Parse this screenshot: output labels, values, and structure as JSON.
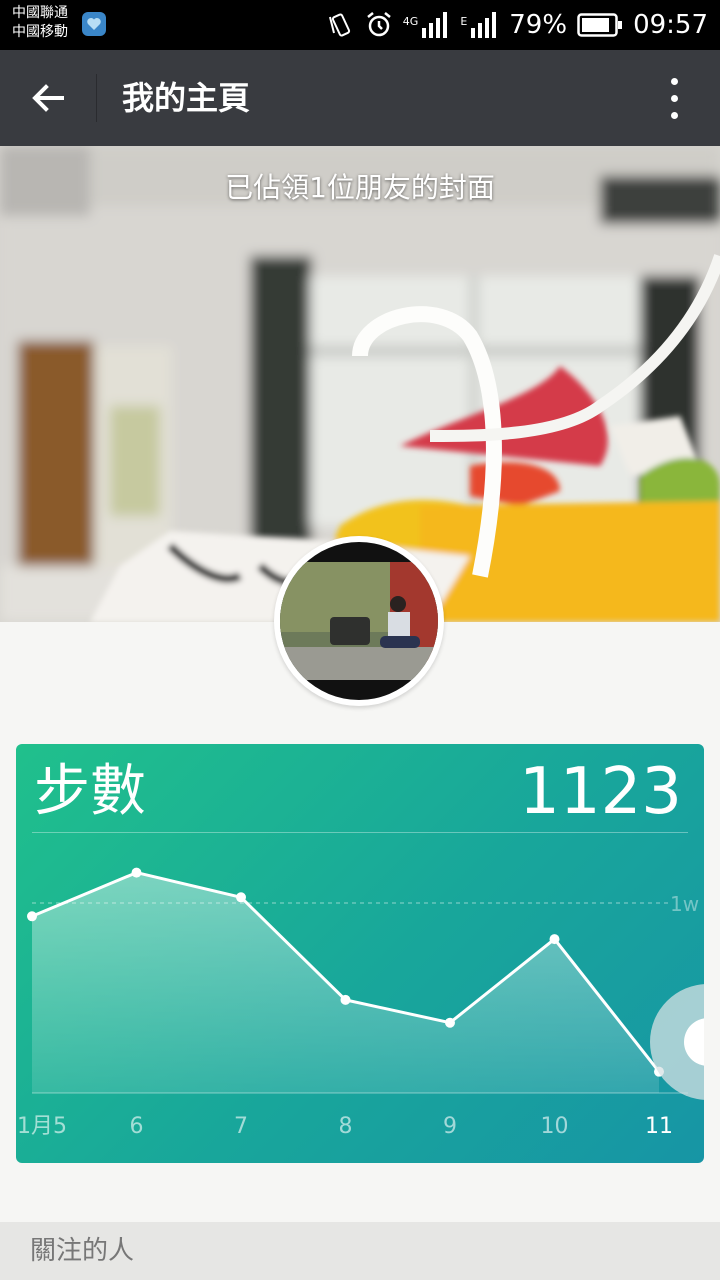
{
  "status": {
    "carrier1": "中國聯通",
    "carrier2": "中國移動",
    "net1": "4G",
    "net2": "E",
    "battery": "79%",
    "time": "09:57"
  },
  "appbar": {
    "title": "我的主頁"
  },
  "cover": {
    "caption": "已佔領1位朋友的封面"
  },
  "steps": {
    "label": "步數",
    "value": "1123",
    "ref_label": "1w",
    "ref_value": 10000
  },
  "chart_data": {
    "type": "line",
    "categories": [
      "1月5",
      "6",
      "7",
      "8",
      "9",
      "10",
      "11"
    ],
    "values": [
      9300,
      11600,
      10300,
      4900,
      3700,
      8100,
      1123
    ],
    "ylim": [
      0,
      14000
    ],
    "ref_line": 10000
  },
  "following": {
    "label": "關注的人"
  },
  "colors": {
    "appbar": "#393b40",
    "card_start": "#20c08c",
    "card_end": "#1795a5"
  }
}
